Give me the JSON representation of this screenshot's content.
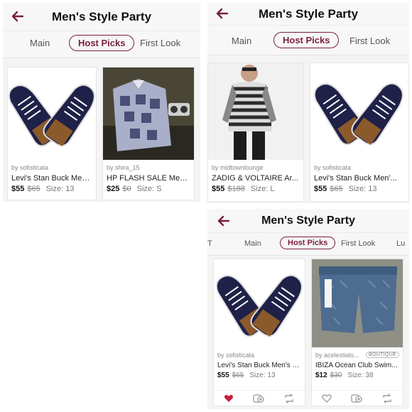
{
  "title": "Men's Style Party",
  "tabs_p1": [
    "Main",
    "Host Picks",
    "First Look"
  ],
  "tabs_p3": [
    "T",
    "Main",
    "Host Picks",
    "First Look",
    "Lu"
  ],
  "colors": {
    "accent": "#7a1f3d",
    "liked": "#c8203a"
  },
  "p1": {
    "cards": [
      {
        "seller": "by sofisticata",
        "name": "Levi's Stan Buck Men'...",
        "price": "$55",
        "orig": "$65",
        "size": "Size: 13",
        "image": "sneakers-image"
      },
      {
        "seller": "by shira_15",
        "name": "HP FLASH SALE Men'...",
        "price": "$25",
        "orig": "$0",
        "size": "Size: S",
        "image": "shirt-image"
      }
    ]
  },
  "p2": {
    "cards": [
      {
        "seller": "by midtownlounge",
        "name": "ZADIG & VOLTAIRE Ar...",
        "price": "$55",
        "orig": "$188",
        "size": "Size: L",
        "image": "striped-sweater-image"
      },
      {
        "seller": "by sofisticata",
        "name": "Levi's Stan Buck Men'...",
        "price": "$55",
        "orig": "$65",
        "size": "Size: 13",
        "image": "sneakers-image"
      }
    ]
  },
  "p3": {
    "cards": [
      {
        "seller": "by sofisticata",
        "name": "Levi's Stan Buck Men's S...",
        "price": "$55",
        "orig": "$65",
        "size": "Size: 13",
        "image": "sneakers-image",
        "liked": true
      },
      {
        "seller": "by acelestials...",
        "boutique": "BOUTIQUE",
        "name": "IBIZA Ocean Club Swim...",
        "price": "$12",
        "orig": "$30",
        "size": "Size: 38",
        "image": "swim-shorts-image",
        "liked": false
      }
    ]
  }
}
